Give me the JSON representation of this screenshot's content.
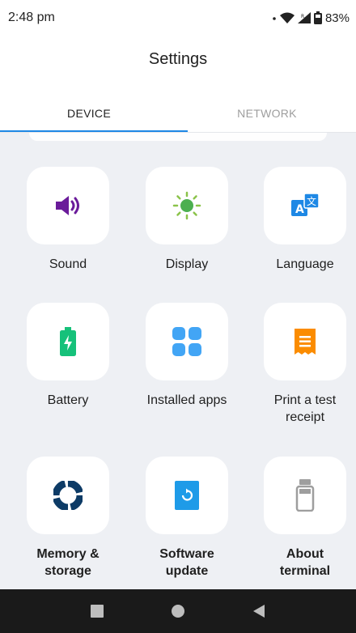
{
  "status_bar": {
    "time": "2:48 pm",
    "battery_percent": "83%"
  },
  "header": {
    "title": "Settings"
  },
  "tabs": [
    {
      "label": "DEVICE",
      "active": true
    },
    {
      "label": "NETWORK",
      "active": false
    }
  ],
  "tiles": [
    {
      "label": "Sound",
      "icon": "speaker-icon",
      "color": "#6a1b9a"
    },
    {
      "label": "Display",
      "icon": "sun-icon",
      "color": "#4caf50"
    },
    {
      "label": "Language",
      "icon": "translate-icon",
      "color": "#1e88e5"
    },
    {
      "label": "Battery",
      "icon": "battery-icon",
      "color": "#16c17a"
    },
    {
      "label": "Installed apps",
      "icon": "apps-grid-icon",
      "color": "#42a5f5"
    },
    {
      "label": "Print a test receipt",
      "icon": "receipt-icon",
      "color": "#fb8c00"
    },
    {
      "label": "Memory & storage",
      "icon": "storage-pie-icon",
      "color": "#0d3b66"
    },
    {
      "label": "Software update",
      "icon": "update-icon",
      "color": "#1e9be8"
    },
    {
      "label": "About terminal",
      "icon": "terminal-device-icon",
      "color": "#9e9e9e"
    }
  ],
  "navigation": {
    "buttons": [
      "recents-square-icon",
      "home-circle-icon",
      "back-triangle-icon"
    ]
  }
}
